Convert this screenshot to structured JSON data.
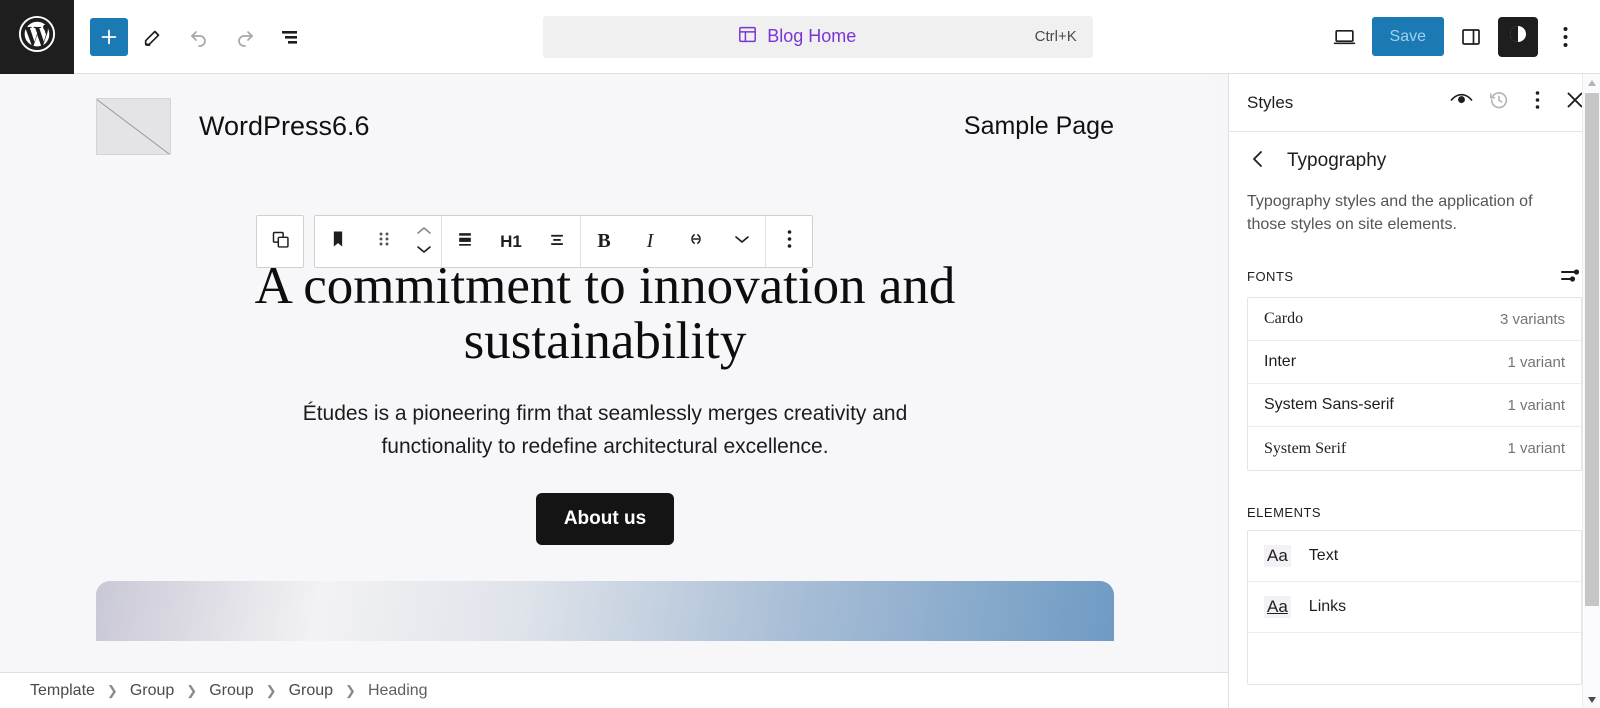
{
  "header": {
    "logo_icon": "wordpress-logo-icon",
    "tools": [
      {
        "name": "add-block-button",
        "icon": "plus-icon",
        "label": ""
      },
      {
        "name": "edit-mode-button",
        "icon": "pencil-icon",
        "label": ""
      },
      {
        "name": "undo-button",
        "icon": "undo-arrow-icon",
        "label": ""
      },
      {
        "name": "redo-button",
        "icon": "redo-arrow-icon",
        "label": ""
      },
      {
        "name": "list-view-button",
        "icon": "list-view-icon",
        "label": ""
      }
    ],
    "command_bar": {
      "icon": "template-layout-icon",
      "title": "Blog Home",
      "shortcut": "Ctrl+K"
    },
    "view_button_icon": "desktop-preview-icon",
    "save_label": "Save",
    "sidebar_toggle_icon": "panel-right-icon",
    "styles_toggle_icon": "contrast-circle-icon",
    "more_options_icon": "vertical-dots-icon",
    "accent_blue": "#1b7ab3",
    "save_text_color": "#9ed1ef",
    "command_purple": "#7b35d4"
  },
  "block_toolbar": {
    "parent_block_icon": "parent-block-icon",
    "block_type_icon": "heading-block-icon",
    "drag_handle_icon": "drag-dots-icon",
    "move_up_icon": "chevron-up-icon",
    "move_down_icon": "chevron-down-icon",
    "align_icon": "align-block-icon",
    "heading_level_label": "H1",
    "text_align_icon": "text-align-icon",
    "bold_label": "B",
    "italic_label": "I",
    "link_icon": "link-icon",
    "more_rich_text_icon": "chevron-down-icon",
    "options_icon": "vertical-dots-icon"
  },
  "canvas": {
    "site_logo_icon": "broken-image-placeholder-icon",
    "site_title": "WordPress6.6",
    "nav_link": "Sample Page",
    "heading": "A commitment to innovation and sustainability",
    "paragraph": "Études is a pioneering firm that seamlessly merges creativity and functionality to redefine architectural excellence.",
    "button_label": "About us",
    "scroll_up_icon": "scroll-up-arrow-icon",
    "scroll_down_icon": "scroll-down-arrow-icon"
  },
  "sidebar": {
    "title": "Styles",
    "header_actions": [
      {
        "name": "style-book-button",
        "icon": "eye-icon"
      },
      {
        "name": "revisions-button",
        "icon": "clock-history-icon"
      },
      {
        "name": "styles-more-options-button",
        "icon": "vertical-dots-icon"
      },
      {
        "name": "close-styles-button",
        "icon": "close-x-icon"
      }
    ],
    "back_icon": "chevron-left-icon",
    "panel_title": "Typography",
    "panel_description": "Typography styles and the application of those styles on site elements.",
    "fonts_section": {
      "label": "FONTS",
      "manage_icon": "sliders-filter-icon",
      "items": [
        {
          "name": "Cardo",
          "variants": "3 variants",
          "style": "serif"
        },
        {
          "name": "Inter",
          "variants": "1 variant",
          "style": "sans"
        },
        {
          "name": "System Sans-serif",
          "variants": "1 variant",
          "style": "sans"
        },
        {
          "name": "System Serif",
          "variants": "1 variant",
          "style": "serif"
        }
      ]
    },
    "elements_section": {
      "label": "ELEMENTS",
      "items": [
        {
          "sample": "Aa",
          "label": "Text",
          "underlined": false
        },
        {
          "sample": "Aa",
          "label": "Links",
          "underlined": true
        }
      ]
    }
  },
  "breadcrumb": {
    "items": [
      "Template",
      "Group",
      "Group",
      "Group",
      "Heading"
    ],
    "separator": "❯"
  }
}
